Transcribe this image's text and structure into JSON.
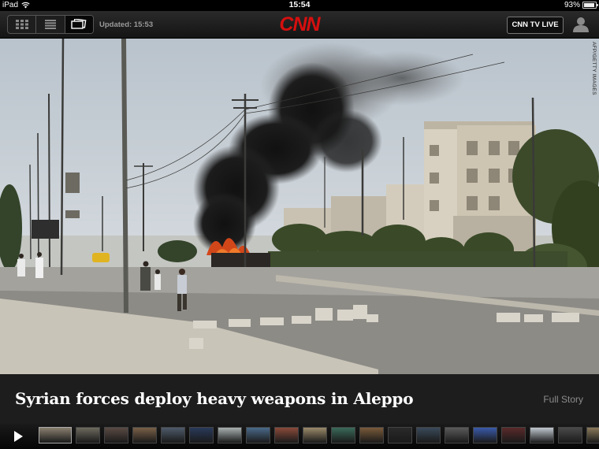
{
  "statusbar": {
    "device": "iPad",
    "time": "15:54",
    "battery": "93%",
    "battery_level": 0.93
  },
  "header": {
    "updated": "Updated: 15:53",
    "logo": "CNN",
    "tv_button": "CNN TV LIVE",
    "views": [
      {
        "icon": "grid-view-icon",
        "active": false
      },
      {
        "icon": "list-view-icon",
        "active": false
      },
      {
        "icon": "slideshow-view-icon",
        "active": true
      }
    ]
  },
  "story": {
    "headline": "Syrian forces deploy heavy weapons in Aleppo",
    "full_story": "Full Story",
    "photo_credit": "AFP/GETTY IMAGES"
  },
  "filmstrip": {
    "play_icon": "play-icon",
    "thumbnails": [
      {
        "color": "#8a8070",
        "active": true
      },
      {
        "color": "#6d6a5e"
      },
      {
        "color": "#5a4a44"
      },
      {
        "color": "#7a6048"
      },
      {
        "color": "#4e5a6a"
      },
      {
        "color": "#2a3a5a"
      },
      {
        "color": "#a8b0b0"
      },
      {
        "color": "#4a6a8a"
      },
      {
        "color": "#8a4a3a"
      },
      {
        "color": "#9a8a6a"
      },
      {
        "color": "#3a6a5a"
      },
      {
        "color": "#7a5a3a"
      },
      {
        "color": "#2a2a2a"
      },
      {
        "color": "#3a4a5a"
      },
      {
        "color": "#5a5a5a"
      },
      {
        "color": "#3a5aaa"
      },
      {
        "color": "#5a2a2a"
      },
      {
        "color": "#c0c8d0"
      },
      {
        "color": "#4a4a4a"
      },
      {
        "color": "#8a7a5a"
      }
    ]
  },
  "colors": {
    "brand": "#d50f0f",
    "caption_bg": "#1d1d1d",
    "muted_text": "#8c8c8c"
  }
}
